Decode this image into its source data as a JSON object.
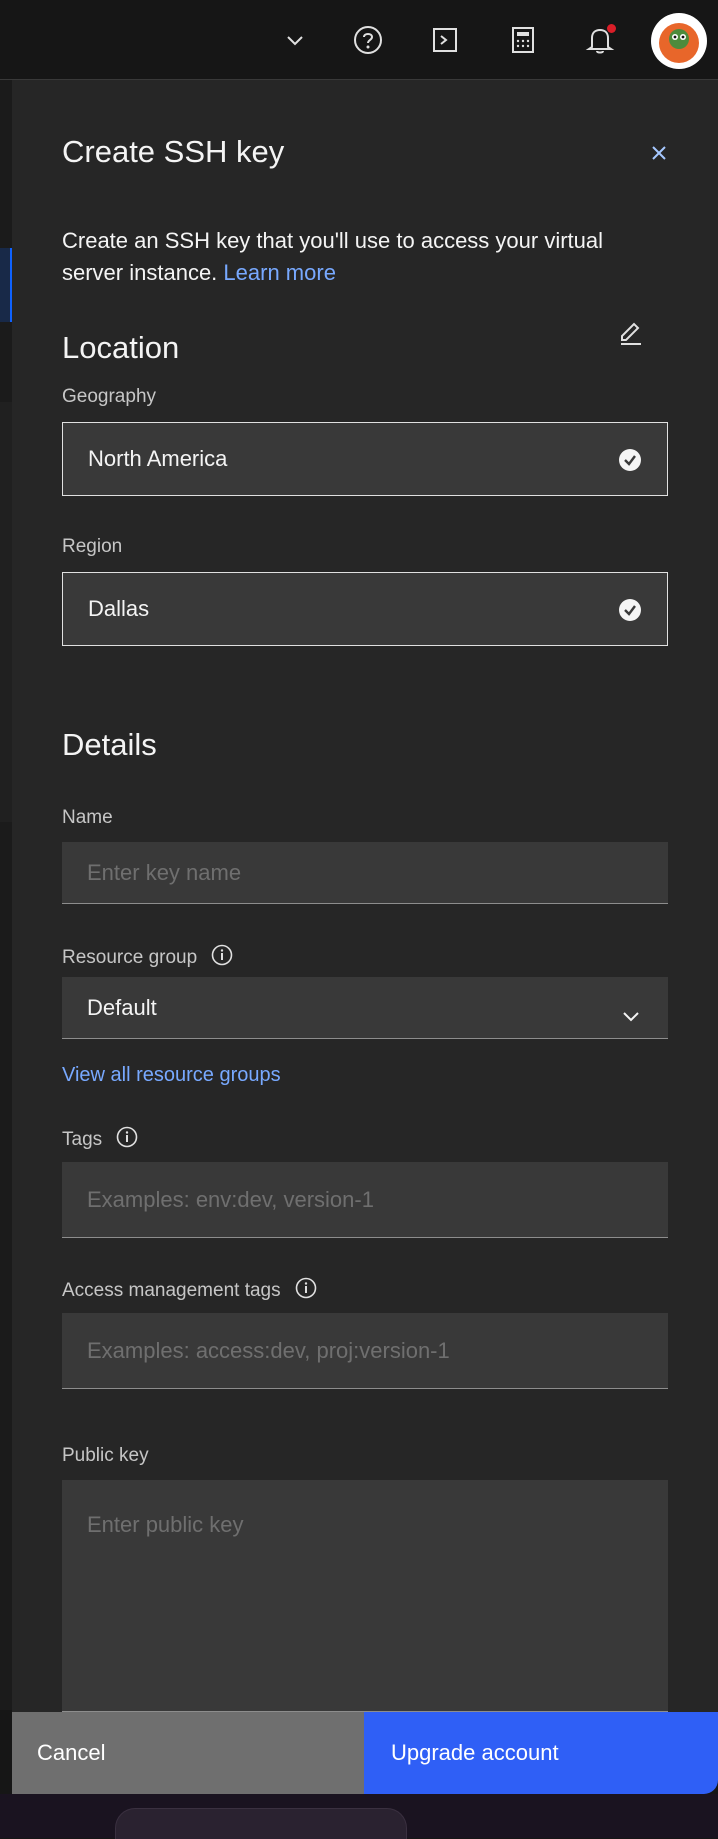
{
  "header": {
    "icons": [
      "chevron-down-icon",
      "help-icon",
      "cloud-shell-icon",
      "cost-estimator-icon",
      "notification-icon",
      "avatar"
    ],
    "notification_badge_color": "#da1e28"
  },
  "panel": {
    "title": "Create SSH key",
    "description": "Create an SSH key that you'll use to access your virtual server instance.",
    "learn_more": "Learn more",
    "location": {
      "heading": "Location",
      "geography_label": "Geography",
      "geography_value": "North America",
      "region_label": "Region",
      "region_value": "Dallas"
    },
    "details": {
      "heading": "Details",
      "name_label": "Name",
      "name_placeholder": "Enter key name",
      "resource_group_label": "Resource group",
      "resource_group_value": "Default",
      "view_resource_groups": "View all resource groups",
      "tags_label": "Tags",
      "tags_placeholder": "Examples: env:dev, version-1",
      "access_tags_label": "Access management tags",
      "access_tags_placeholder": "Examples: access:dev, proj:version-1",
      "public_key_label": "Public key",
      "public_key_placeholder": "Enter public key"
    }
  },
  "footer": {
    "cancel": "Cancel",
    "upgrade": "Upgrade account"
  },
  "colors": {
    "panel_bg": "#262626",
    "field_bg": "#393939",
    "link": "#78a9ff",
    "primary": "#2f5ff6",
    "secondary": "#6f6f6f"
  }
}
